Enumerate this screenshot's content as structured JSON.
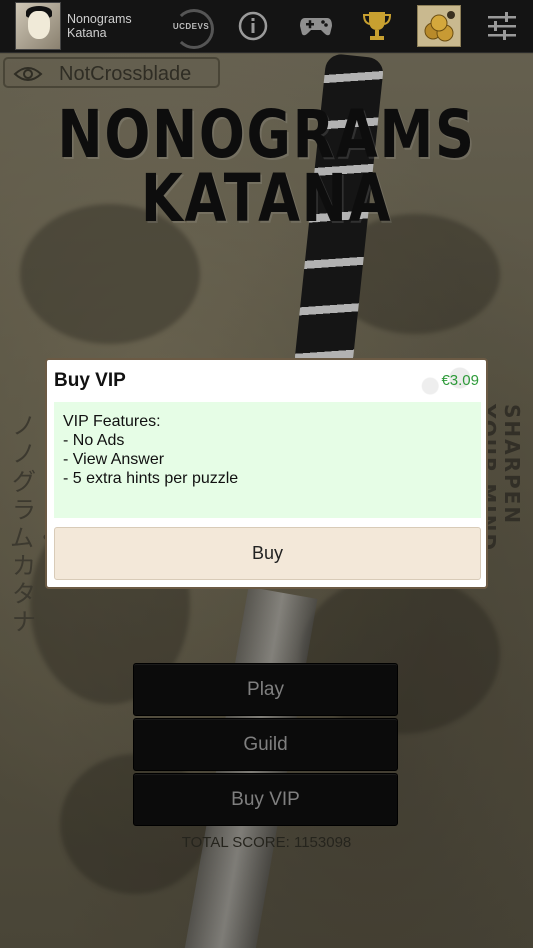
{
  "app": {
    "title_line1": "Nonograms",
    "title_line2": "Katana",
    "publisher": "UCDEVS"
  },
  "toolbar": {
    "icons": [
      "ucdevs-logo-icon",
      "info-icon",
      "gamepad-icon",
      "trophy-icon",
      "coins-icon",
      "settings-sliders-icon"
    ]
  },
  "user": {
    "name": "NotCrossblade"
  },
  "logo": {
    "line1": "NONOGRAMS",
    "line2": "KATANA"
  },
  "side_text": {
    "japanese": "ノノグラム・カタナ",
    "english": "SHARPEN YOUR MIND"
  },
  "dialog": {
    "title": "Buy VIP",
    "price": "€3.09",
    "features": [
      "VIP Features:",
      "- No Ads",
      "- View Answer",
      "- 5 extra hints per puzzle"
    ],
    "buy_label": "Buy"
  },
  "menu": {
    "play": "Play",
    "guild": "Guild",
    "buy_vip": "Buy VIP"
  },
  "score": {
    "text": "TOTAL SCORE: 1153098"
  },
  "colors": {
    "price": "#2e9b3a",
    "features_bg": "#e6fde6",
    "buy_bg": "#f3e8d9",
    "topbar": "#141414"
  }
}
